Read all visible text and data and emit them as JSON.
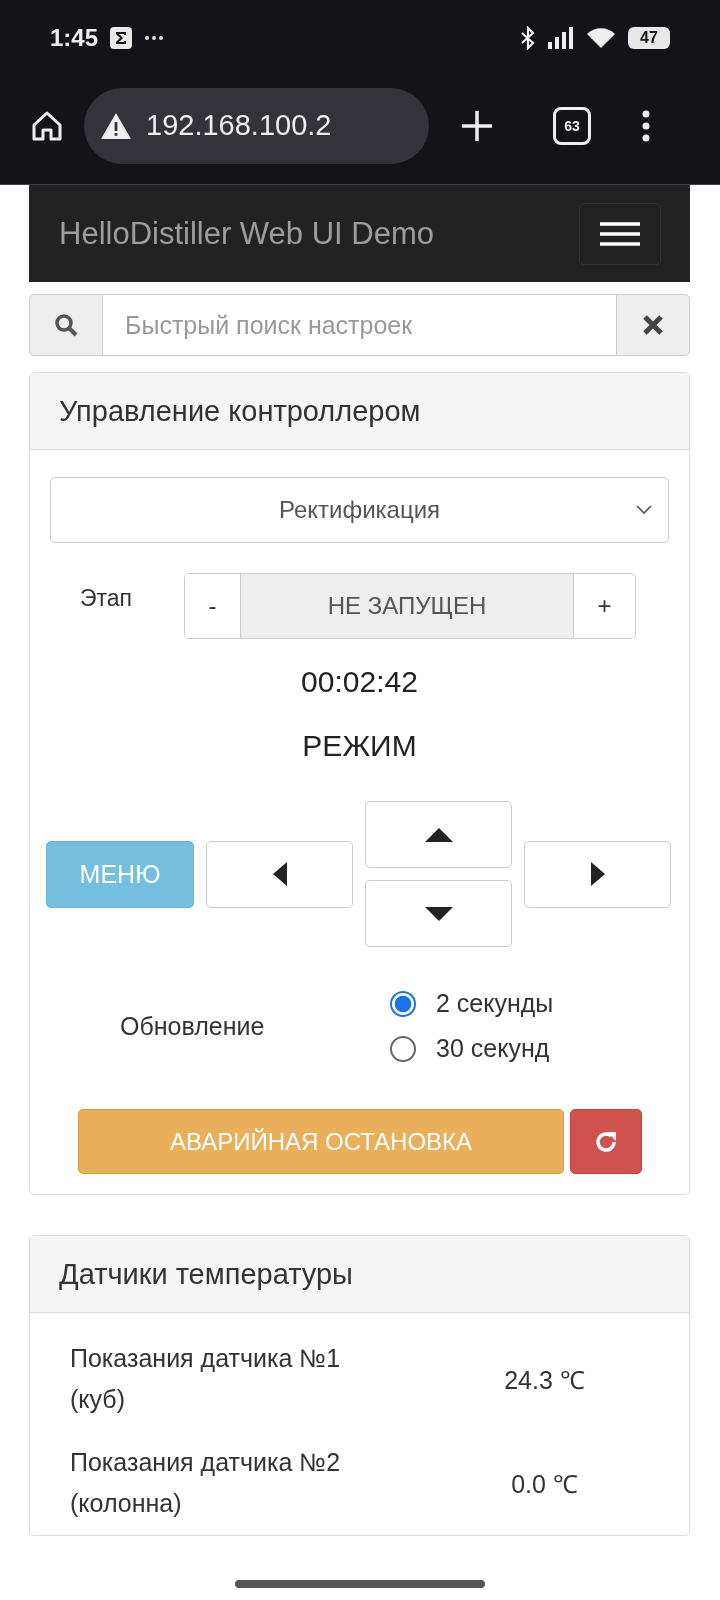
{
  "status_bar": {
    "time": "1:45",
    "battery": "47"
  },
  "browser": {
    "url": "192.168.100.2",
    "tab_count": "63"
  },
  "navbar": {
    "title": "HelloDistiller Web UI Demo"
  },
  "search": {
    "placeholder": "Быстрый поиск настроек"
  },
  "control_panel": {
    "title": "Управление контроллером",
    "mode_select": "Ректификация",
    "stage_label": "Этап",
    "stage_minus": "-",
    "stage_value": "НЕ ЗАПУЩЕН",
    "stage_plus": "+",
    "timer": "00:02:42",
    "mode_label": "РЕЖИМ",
    "menu_button": "МЕНЮ",
    "refresh": {
      "label": "Обновление",
      "options": [
        {
          "label": "2 секунды",
          "selected": true
        },
        {
          "label": "30 секунд",
          "selected": false
        }
      ]
    },
    "emergency_button": "АВАРИЙНАЯ ОСТАНОВКА"
  },
  "sensors": {
    "title": "Датчики температуры",
    "rows": [
      {
        "name": "Показания датчика №1 (куб)",
        "value": "24.3 ℃"
      },
      {
        "name": "Показания датчика №2 (колонна)",
        "value": "0.0 ℃"
      }
    ]
  }
}
